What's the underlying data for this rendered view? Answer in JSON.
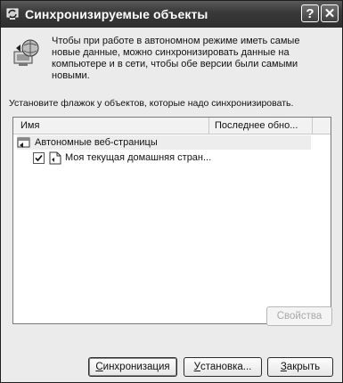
{
  "window": {
    "title": "Синхронизируемые объекты",
    "help_glyph": "?",
    "close_glyph": "✕"
  },
  "intro": {
    "text": "Чтобы при работе в автономном режиме иметь самые новые данные, можно синхронизировать данные на компьютере и в сети, чтобы обе версии были самыми новыми."
  },
  "instruction": "Установите флажок у объектов, которые надо синхронизировать.",
  "list": {
    "columns": [
      "Имя",
      "Последнее обно..."
    ],
    "group": {
      "label": "Автономные веб-страницы",
      "icon": "offline-pages-icon"
    },
    "items": [
      {
        "label": "Моя текущая домашняя стран...",
        "checked": true,
        "icon": "web-page-icon"
      }
    ]
  },
  "buttons": {
    "properties": "Свойства",
    "sync_prefix": "",
    "sync_mnemonic": "С",
    "sync_rest": "инхронизация",
    "setup_mnemonic": "У",
    "setup_rest": "становка...",
    "close_mnemonic": "З",
    "close_rest": "акрыть"
  },
  "colors": {
    "titlebar": "#3a3a3a",
    "dialog_bg": "#ebebeb",
    "list_bg": "#ffffff"
  }
}
